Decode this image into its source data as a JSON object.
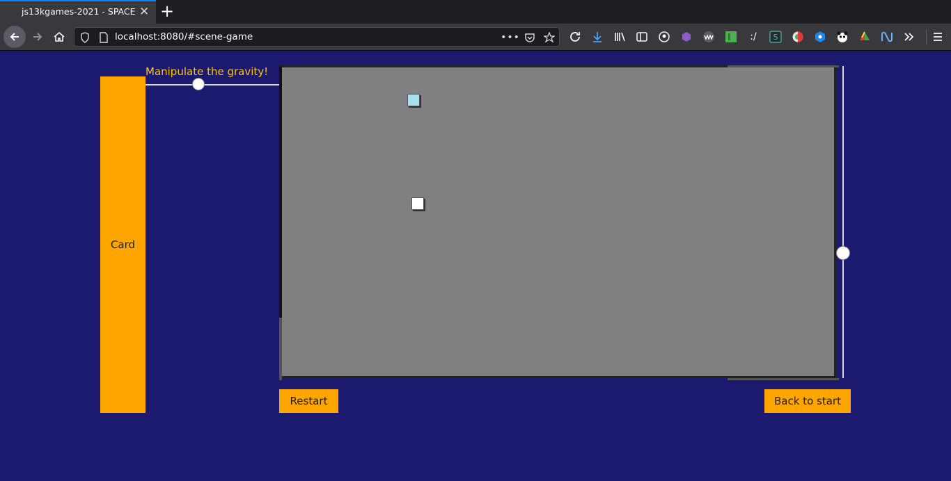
{
  "browser": {
    "tab_title": "js13kgames-2021 - SPACE",
    "url": "localhost:8080/#scene-game"
  },
  "game": {
    "card_label": "Card",
    "gravity_label": "Manipulate the gravity!",
    "restart_label": "Restart",
    "back_label": "Back to start"
  },
  "colors": {
    "page_background": "#1b1a6e",
    "accent": "#ffa500",
    "label_yellow": "#ffc40c",
    "board": "#808080"
  }
}
